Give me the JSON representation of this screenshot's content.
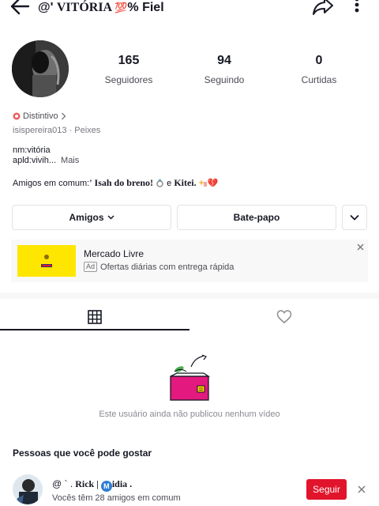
{
  "header": {
    "title_prefix": "@' ",
    "title_serif": "VITÓRIA ",
    "title_hundred": "💯",
    "title_suffix": "% Fiel"
  },
  "stats": [
    {
      "value": "165",
      "label": "Seguidores"
    },
    {
      "value": "94",
      "label": "Seguindo"
    },
    {
      "value": "0",
      "label": "Curtidas"
    }
  ],
  "profile": {
    "badge_label": "Distintivo",
    "username": "isispereira013",
    "sign": "Peixes",
    "bio_line1": "nm:vitória",
    "bio_line2": "apld:vivih...",
    "bio_more": "Mais",
    "mutual_prefix": "Amigos em comum:",
    "mutual_name1": "' Isah do breno!",
    "mutual_sep": " e ",
    "mutual_name2": "Kitei.",
    "mutual_emoji": "💔"
  },
  "actions": {
    "friends_label": "Amigos",
    "chat_label": "Bate-papo"
  },
  "ad": {
    "title": "Mercado Livre",
    "tag": "Ad",
    "subtitle": "Ofertas diárias com entrega rápida",
    "logo_text": "MERCADO LIVRE"
  },
  "content": {
    "empty_text": "Este usuário ainda não publicou nenhum vídeo"
  },
  "suggestions": {
    "title": "Pessoas que você pode gostar",
    "items": [
      {
        "name_prefix": "@ ` .",
        "name_bold": " Rick | ",
        "name_m": "M",
        "name_rest": "idia .",
        "subtitle": "Vocês têm 28 amigos em comum",
        "follow_label": "Seguir"
      }
    ]
  },
  "colors": {
    "follow_red": "#e1142b",
    "ad_yellow": "#ffe600",
    "box_pink": "#e3197f"
  }
}
